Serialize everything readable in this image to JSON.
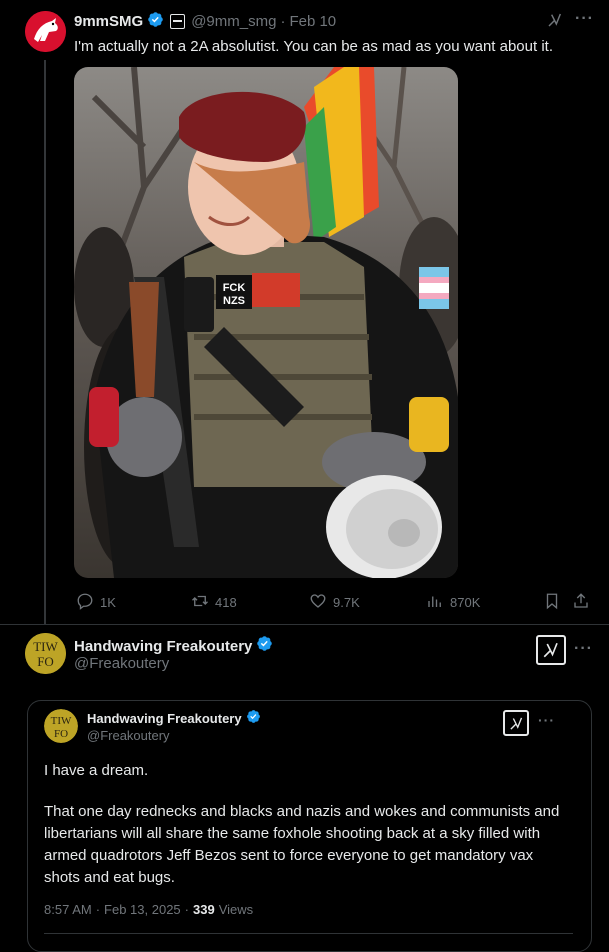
{
  "tweet1": {
    "display_name": "9mmSMG",
    "handle": "@9mm_smg",
    "separator": "·",
    "date": "Feb 10",
    "text": "I'm actually not a 2A absolutist. You can be as mad as you want about it.",
    "more": "···",
    "actions": {
      "replies": "1K",
      "reposts": "418",
      "likes": "9.7K",
      "views": "870K"
    },
    "photo_patches": {
      "patch1_line1": "FCK",
      "patch1_line2": "NZS"
    }
  },
  "tweet2": {
    "display_name": "Handwaving Freakoutery",
    "handle": "@Freakoutery",
    "more": "···",
    "avatar_text": {
      "line1": "TIW",
      "line2": "FO"
    },
    "quoted": {
      "display_name": "Handwaving Freakoutery",
      "handle": "@Freakoutery",
      "more": "···",
      "paragraph1": "I have a dream.",
      "paragraph2": "That one day rednecks and blacks and nazis and wokes and communists and libertarians will all share the same foxhole shooting back at a sky filled with armed quadrotors Jeff Bezos sent to force everyone to get mandatory vax shots and eat bugs.",
      "time": "8:57 AM",
      "sep": "·",
      "date": "Feb 13, 2025",
      "sep2": "·",
      "views_count": "339",
      "views_label": "Views"
    }
  },
  "colors": {
    "background": "#000000",
    "text": "#e7e9ea",
    "muted": "#71767b",
    "verified": "#1d9bf0",
    "border": "#2f3336"
  },
  "icons": [
    "verified-badge-icon",
    "grok-icon",
    "more-icon",
    "reply-icon",
    "repost-icon",
    "like-icon",
    "views-icon",
    "bookmark-icon",
    "share-icon"
  ]
}
